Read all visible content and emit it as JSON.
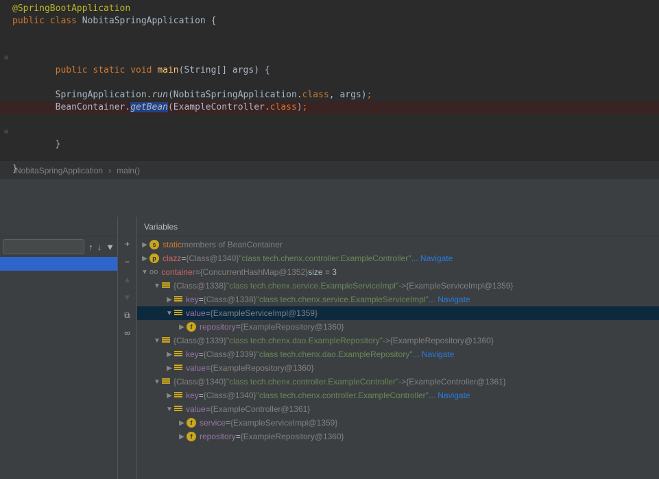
{
  "code": {
    "annotation": "@SpringBootApplication",
    "line2": {
      "mods": "public class ",
      "name": "NobitaSpringApplication ",
      "brace": "{"
    },
    "line4": {
      "mods": "    public static void ",
      "method": "main",
      "params": "(String[] args) ",
      "brace": "{"
    },
    "line5": {
      "a": "        SpringApplication.",
      "b": "run",
      "c": "(NobitaSpringApplication.",
      "d": "class",
      "e": ", args)",
      "f": ";"
    },
    "line6": {
      "a": "        BeanContainer.",
      "b": "getBean",
      "c": "(ExampleController.",
      "d": "class",
      "e": ")",
      "f": ";"
    },
    "line7": "    }",
    "line8": "}"
  },
  "breadcrumb": {
    "a": "NobitaSpringApplication",
    "sep": "›",
    "b": "main()"
  },
  "vars": {
    "header": "Variables",
    "static_kw": "static",
    "static_lbl": " members of BeanContainer",
    "clazz": {
      "name": "clazz",
      "obj": "{Class@1340}",
      "str": "\"class tech.chenx.controller.ExampleController\"",
      "nav": "... Navigate"
    },
    "container": {
      "name": "container",
      "obj": "{ConcurrentHashMap@1352}",
      "size": "size = 3"
    },
    "e1": {
      "obj": "{Class@1338}",
      "str": "\"class tech.chenx.service.ExampleServiceImpl\"",
      "map": "{ExampleServiceImpl@1359}"
    },
    "e1key": {
      "name": "key",
      "obj": "{Class@1338}",
      "str": "\"class tech.chenx.service.ExampleServiceImpl\"",
      "nav": "... Navigate"
    },
    "e1val": {
      "name": "value",
      "obj": "{ExampleServiceImpl@1359}"
    },
    "e1repo": {
      "name": "repository",
      "obj": "{ExampleRepository@1360}"
    },
    "e2": {
      "obj": "{Class@1339}",
      "str": "\"class tech.chenx.dao.ExampleRepository\"",
      "map": "{ExampleRepository@1360}"
    },
    "e2key": {
      "name": "key",
      "obj": "{Class@1339}",
      "str": "\"class tech.chenx.dao.ExampleRepository\"",
      "nav": "... Navigate"
    },
    "e2val": {
      "name": "value",
      "obj": "{ExampleRepository@1360}"
    },
    "e3": {
      "obj": "{Class@1340}",
      "str": "\"class tech.chenx.controller.ExampleController\"",
      "map": "{ExampleController@1361}"
    },
    "e3key": {
      "name": "key",
      "obj": "{Class@1340}",
      "str": "\"class tech.chenx.controller.ExampleController\"",
      "nav": "... Navigate"
    },
    "e3val": {
      "name": "value",
      "obj": "{ExampleController@1361}"
    },
    "e3svc": {
      "name": "service",
      "obj": "{ExampleServiceImpl@1359}"
    },
    "e3repo": {
      "name": "repository",
      "obj": "{ExampleRepository@1360}"
    },
    "eq": " = ",
    "arrow": " -> "
  }
}
